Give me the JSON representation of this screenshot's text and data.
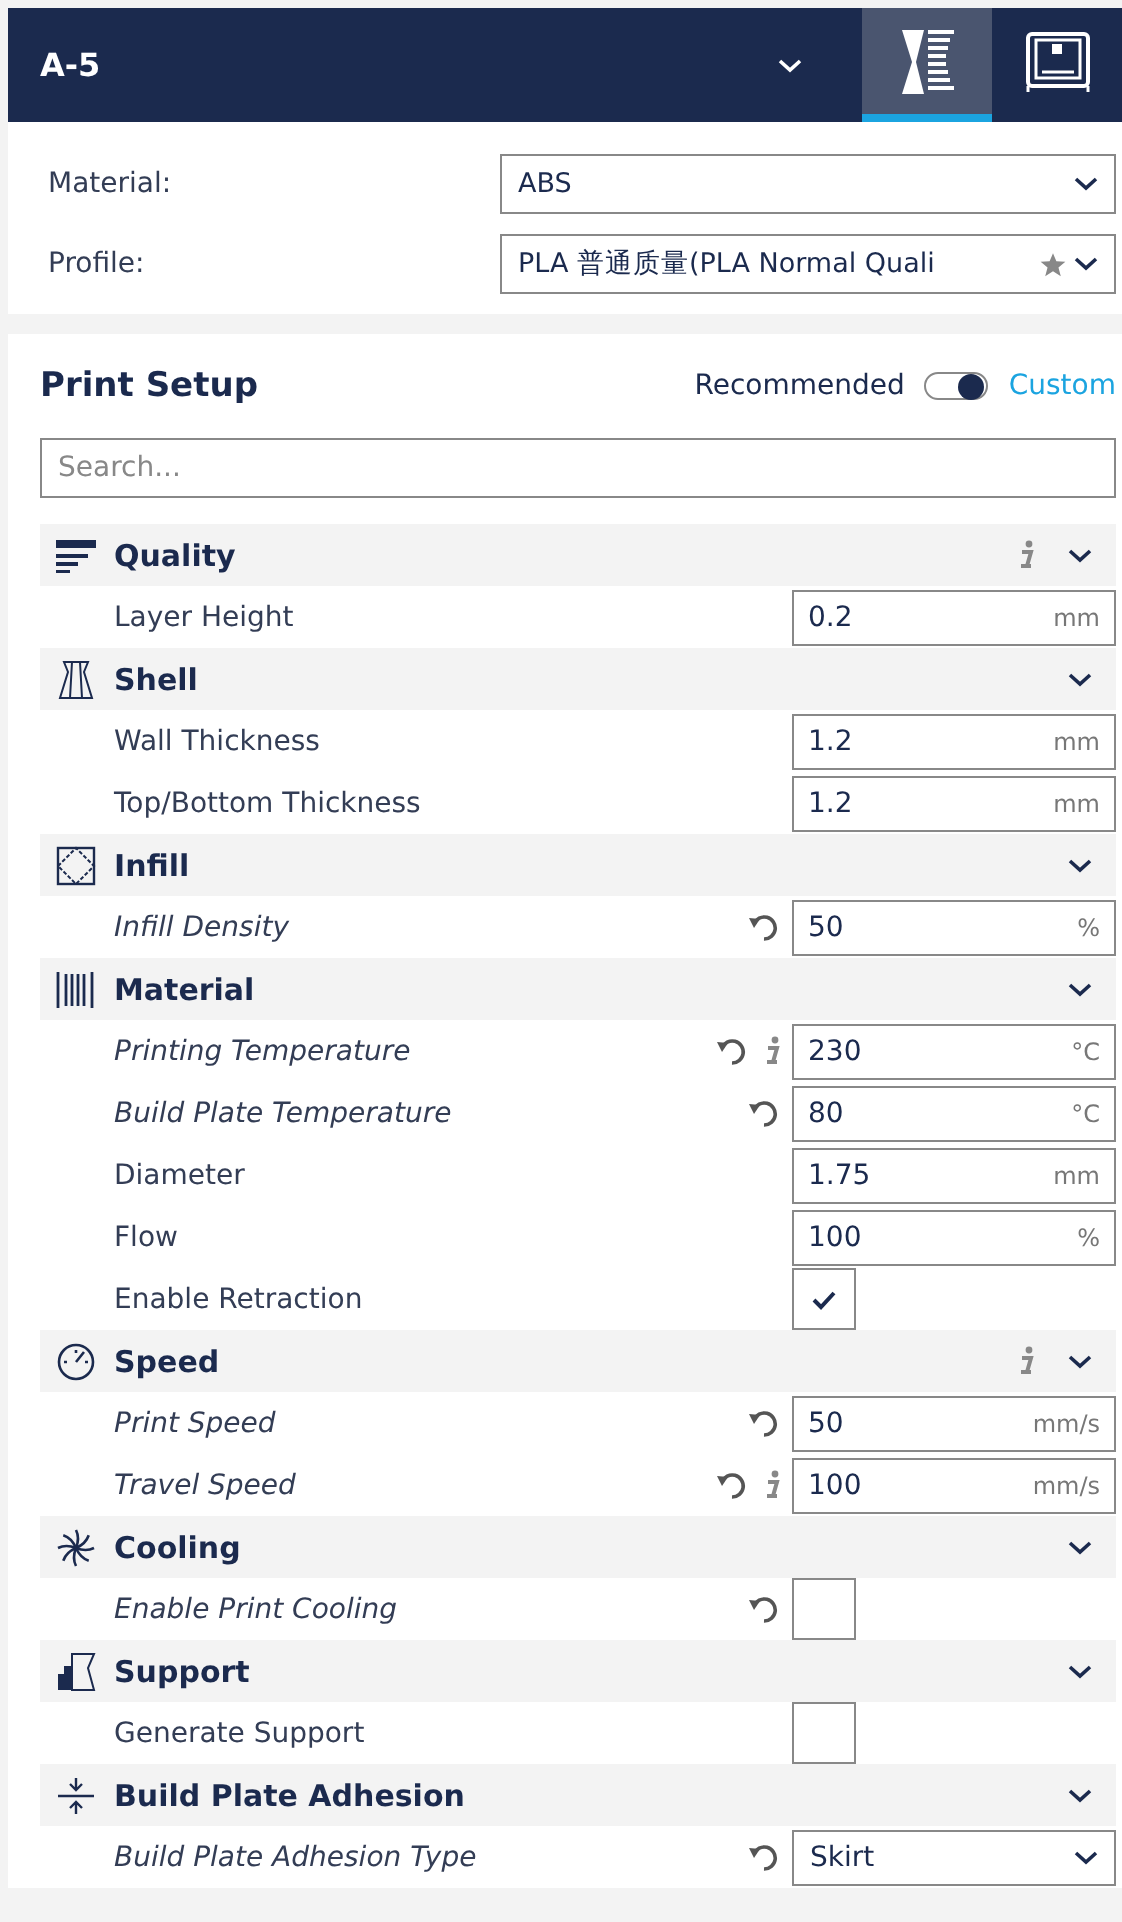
{
  "header": {
    "printer": "A-5",
    "tabs": [
      {
        "selected": true
      },
      {
        "selected": false
      }
    ]
  },
  "material_profile": [
    {
      "label": "Material:",
      "value": "ABS",
      "starred": false
    },
    {
      "label": "Profile:",
      "value": "PLA 普通质量(PLA Normal Quali",
      "starred": true
    }
  ],
  "print_setup": {
    "title": "Print Setup",
    "modes": [
      {
        "label": "Recommended",
        "selected": false
      },
      {
        "label": "Custom",
        "selected": true
      }
    ],
    "search": {
      "placeholder": "Search..."
    },
    "categories": [
      {
        "name": "Quality",
        "info": true,
        "settings": [
          {
            "label": "Layer Height",
            "kind": "field",
            "value": "0.2",
            "unit": "mm",
            "modified": false,
            "info": false
          }
        ]
      },
      {
        "name": "Shell",
        "info": false,
        "settings": [
          {
            "label": "Wall Thickness",
            "kind": "field",
            "value": "1.2",
            "unit": "mm",
            "modified": false,
            "info": false
          },
          {
            "label": "Top/Bottom Thickness",
            "kind": "field",
            "value": "1.2",
            "unit": "mm",
            "modified": false,
            "info": false
          }
        ]
      },
      {
        "name": "Infill",
        "info": false,
        "settings": [
          {
            "label": "Infill Density",
            "kind": "field",
            "value": "50",
            "unit": "%",
            "modified": true,
            "info": false
          }
        ]
      },
      {
        "name": "Material",
        "info": false,
        "settings": [
          {
            "label": "Printing Temperature",
            "kind": "field",
            "value": "230",
            "unit": "°C",
            "modified": true,
            "info": true
          },
          {
            "label": "Build Plate Temperature",
            "kind": "field",
            "value": "80",
            "unit": "°C",
            "modified": true,
            "info": false
          },
          {
            "label": "Diameter",
            "kind": "field",
            "value": "1.75",
            "unit": "mm",
            "modified": false,
            "info": false
          },
          {
            "label": "Flow",
            "kind": "field",
            "value": "100",
            "unit": "%",
            "modified": false,
            "info": false
          },
          {
            "label": "Enable Retraction",
            "kind": "checkbox",
            "checked": true,
            "modified": false,
            "info": false
          }
        ]
      },
      {
        "name": "Speed",
        "info": true,
        "settings": [
          {
            "label": "Print Speed",
            "kind": "field",
            "value": "50",
            "unit": "mm/s",
            "modified": true,
            "info": false
          },
          {
            "label": "Travel Speed",
            "kind": "field",
            "value": "100",
            "unit": "mm/s",
            "modified": true,
            "info": true
          }
        ]
      },
      {
        "name": "Cooling",
        "info": false,
        "settings": [
          {
            "label": "Enable Print Cooling",
            "kind": "checkbox",
            "checked": false,
            "modified": true,
            "info": false
          }
        ]
      },
      {
        "name": "Support",
        "info": false,
        "settings": [
          {
            "label": "Generate Support",
            "kind": "checkbox",
            "checked": false,
            "modified": false,
            "info": false
          }
        ]
      },
      {
        "name": "Build Plate Adhesion",
        "info": false,
        "settings": [
          {
            "label": "Build Plate Adhesion Type",
            "kind": "dropdown",
            "value": "Skirt",
            "modified": true,
            "info": false
          }
        ]
      }
    ]
  }
}
